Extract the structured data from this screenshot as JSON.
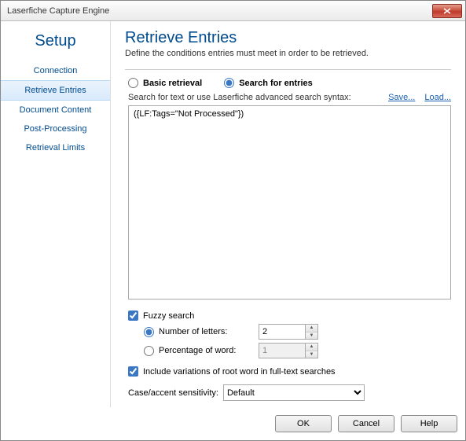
{
  "window": {
    "title": "Laserfiche Capture Engine"
  },
  "sidebar": {
    "title": "Setup",
    "items": [
      {
        "label": "Connection",
        "selected": false
      },
      {
        "label": "Retrieve Entries",
        "selected": true
      },
      {
        "label": "Document Content",
        "selected": false
      },
      {
        "label": "Post-Processing",
        "selected": false
      },
      {
        "label": "Retrieval Limits",
        "selected": false
      }
    ]
  },
  "main": {
    "title": "Retrieve Entries",
    "subtitle": "Define the conditions entries must meet in order to be retrieved.",
    "mode": {
      "basic_label": "Basic retrieval",
      "search_label": "Search for entries",
      "selected": "search"
    },
    "search_hint": "Search for text or use Laserfiche advanced search syntax:",
    "save_link": "Save...",
    "load_link": "Load...",
    "search_text": "({LF:Tags=\"Not Processed\"})",
    "fuzzy": {
      "label": "Fuzzy search",
      "checked": true,
      "letters_label": "Number of letters:",
      "letters_value": "2",
      "letters_selected": true,
      "percent_label": "Percentage of word:",
      "percent_value": "1",
      "percent_selected": false
    },
    "variations": {
      "label": "Include variations of root word in full-text searches",
      "checked": true
    },
    "case_sensitivity": {
      "label": "Case/accent sensitivity:",
      "value": "Default"
    }
  },
  "buttons": {
    "ok": "OK",
    "cancel": "Cancel",
    "help": "Help"
  }
}
